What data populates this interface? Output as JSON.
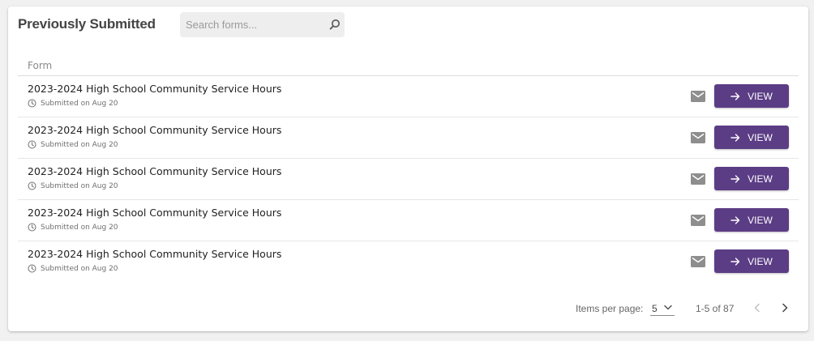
{
  "panel": {
    "title": "Previously Submitted",
    "search": {
      "placeholder": "Search forms...",
      "value": ""
    }
  },
  "table": {
    "column_header": "Form",
    "rows": [
      {
        "title": "2023-2024 High School Community Service Hours",
        "submitted": "Submitted on Aug 20",
        "action_label": "VIEW"
      },
      {
        "title": "2023-2024 High School Community Service Hours",
        "submitted": "Submitted on Aug 20",
        "action_label": "VIEW"
      },
      {
        "title": "2023-2024 High School Community Service Hours",
        "submitted": "Submitted on Aug 20",
        "action_label": "VIEW"
      },
      {
        "title": "2023-2024 High School Community Service Hours",
        "submitted": "Submitted on Aug 20",
        "action_label": "VIEW"
      },
      {
        "title": "2023-2024 High School Community Service Hours",
        "submitted": "Submitted on Aug 20",
        "action_label": "VIEW"
      }
    ]
  },
  "paginator": {
    "items_per_page_label": "Items per page:",
    "items_per_page_value": "5",
    "range_label": "1-5 of 87"
  },
  "icons": {
    "search": "search-icon",
    "clock": "clock-icon",
    "mail": "mail-icon",
    "arrow": "arrow-right-icon",
    "dropdown": "chevron-down-icon",
    "prev": "chevron-left-icon",
    "next": "chevron-right-icon"
  },
  "colors": {
    "accent": "#5b3d85",
    "icon_gray": "#8e8e8e",
    "background": "#f1f1f1"
  }
}
